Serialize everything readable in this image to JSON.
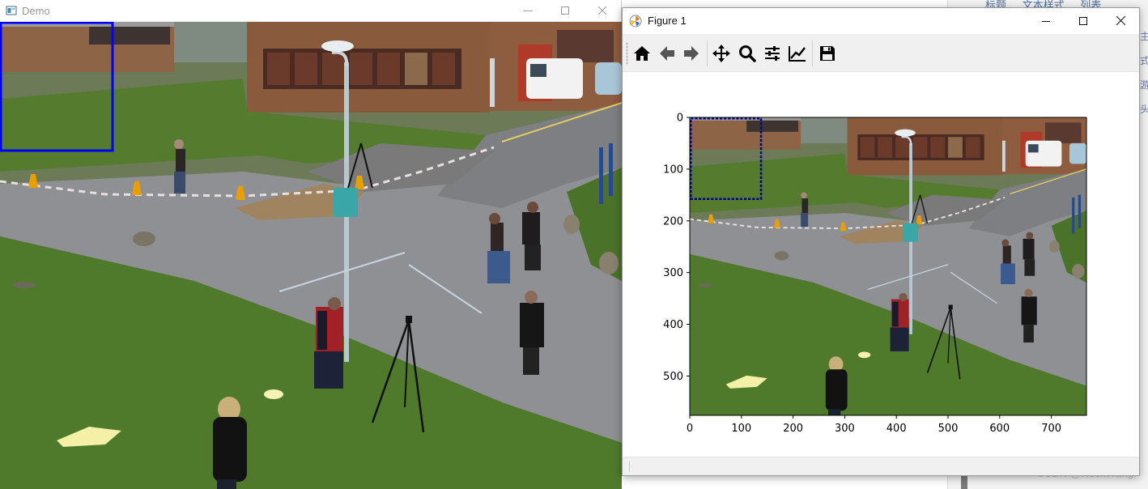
{
  "demo_window": {
    "title": "Demo",
    "controls": {
      "minimize": "minimize",
      "maximize": "maximize",
      "close": "close"
    }
  },
  "figure_window": {
    "title": "Figure 1",
    "toolbar": [
      {
        "name": "home",
        "icon": "home-icon"
      },
      {
        "name": "back",
        "icon": "arrow-left-icon"
      },
      {
        "name": "forward",
        "icon": "arrow-right-icon"
      },
      {
        "name": "pan",
        "icon": "move-icon"
      },
      {
        "name": "zoom",
        "icon": "magnifier-icon"
      },
      {
        "name": "subplots",
        "icon": "sliders-icon"
      },
      {
        "name": "edit-axes",
        "icon": "line-chart-icon"
      },
      {
        "name": "save",
        "icon": "floppy-disk-icon"
      }
    ],
    "status_message": "",
    "plot": {
      "x_ticks": [
        "0",
        "100",
        "200",
        "300",
        "400",
        "500",
        "600",
        "700"
      ],
      "y_ticks": [
        "0",
        "100",
        "200",
        "300",
        "400",
        "500"
      ],
      "x_range": [
        0,
        768
      ],
      "y_range": [
        0,
        576
      ],
      "y_inverted": true,
      "image_box": {
        "x_min": 0,
        "y_min": 0,
        "x_max": 140,
        "y_max": 160
      },
      "image_box_color": "#0000ff"
    }
  },
  "demo_overlay_box": {
    "x_min": 0,
    "y_min": 0,
    "x_max": 140,
    "y_max": 160,
    "color": "#0000ff"
  },
  "background_app": {
    "tabs": [
      "标题",
      "文本样式",
      "列表"
    ],
    "side_glyphs": [
      "主",
      "式",
      "游",
      "头"
    ],
    "watermark": "CSDN @RockWang."
  },
  "colors": {
    "grass": "#4f7a2c",
    "road": "#8e8e90",
    "brick": "#8a5a3c"
  }
}
